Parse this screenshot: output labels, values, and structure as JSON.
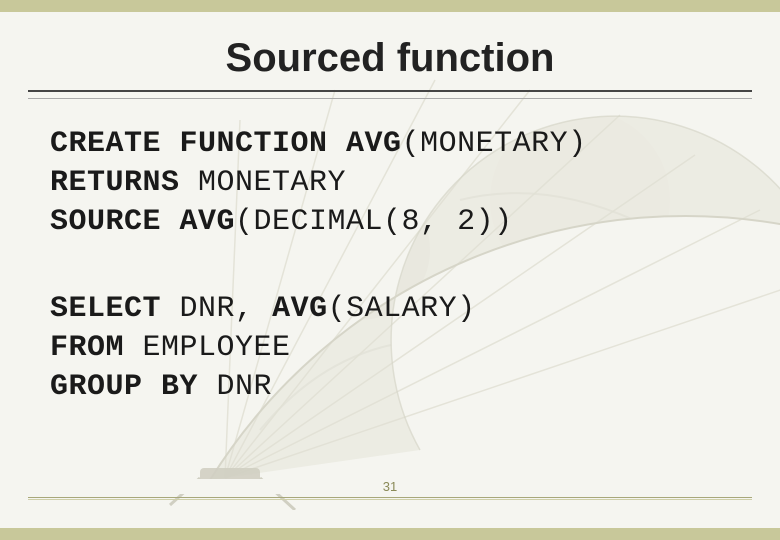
{
  "title": "Sourced function",
  "code1": {
    "line1a": "CREATE FUNCTION AVG",
    "line1b": "(MONETARY)",
    "line2a": "RETURNS",
    "line2b": " MONETARY",
    "line3a": "SOURCE AVG",
    "line3b": "(DECIMAL(8, 2))"
  },
  "code2": {
    "line1a": "SELECT",
    "line1b": " DNR, ",
    "line1c": "AVG",
    "line1d": "(SALARY)",
    "line2a": "FROM",
    "line2b": " EMPLOYEE",
    "line3a": "GROUP BY",
    "line3b": " DNR"
  },
  "page_number": "31"
}
